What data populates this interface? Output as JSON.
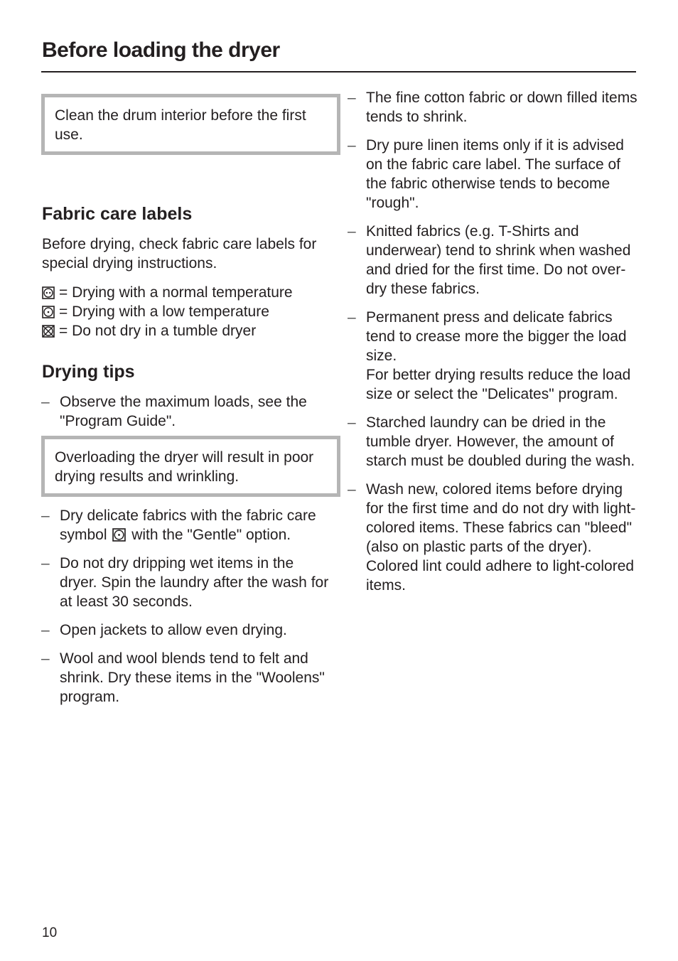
{
  "page": {
    "title": "Before loading the dryer",
    "page_number": "10"
  },
  "notes": {
    "clean_drum": "Clean the drum interior before the first use.",
    "overloading": "Overloading the dryer will result in poor drying results and wrinkling."
  },
  "fabric_care": {
    "heading": "Fabric care labels",
    "intro": "Before drying, check fabric care labels for special drying instructions.",
    "symbols": [
      {
        "icon": "tumble-dry-normal-icon",
        "text": "= Drying with a normal temperature"
      },
      {
        "icon": "tumble-dry-low-icon",
        "text": "= Drying with a low temperature"
      },
      {
        "icon": "do-not-tumble-dry-icon",
        "text": "= Do not dry in a tumble dryer"
      }
    ]
  },
  "drying_tips": {
    "heading": "Drying tips",
    "dash": "–",
    "first_item": "Observe the maximum loads, see the \"Program Guide\".",
    "delicate_item": {
      "before": "Dry delicate fabrics with the fabric care symbol",
      "icon": "tumble-dry-low-icon",
      "after": "with the \"Gentle\" option."
    },
    "left_items": [
      "Do not dry dripping wet items in the dryer. Spin the laundry after the wash for at least 30 seconds.",
      "Open jackets to allow even drying.",
      "Wool and wool blends tend to felt and shrink. Dry these items in the \"Woolens\" program."
    ],
    "right_items": [
      "The fine cotton fabric or down filled items tends to shrink.",
      "Dry pure linen items only if it is advised on the fabric care label. The surface of the fabric otherwise tends to become \"rough\".",
      "Knitted fabrics (e.g. T-Shirts and underwear)  tend to shrink when washed and dried for the first time. Do not over-dry these fabrics.",
      "Permanent press and delicate fabrics tend to crease more the bigger the load size.\nFor better drying results reduce the load size or select the \"Delicates\" program.",
      "Starched laundry can be dried in the tumble dryer. However, the amount of starch must be doubled during the wash.",
      "Wash new, colored items before drying for the first time and do not dry with light-colored items. These fabrics can \"bleed\" (also on plastic parts of the dryer). Colored lint could adhere to light-colored items."
    ]
  }
}
